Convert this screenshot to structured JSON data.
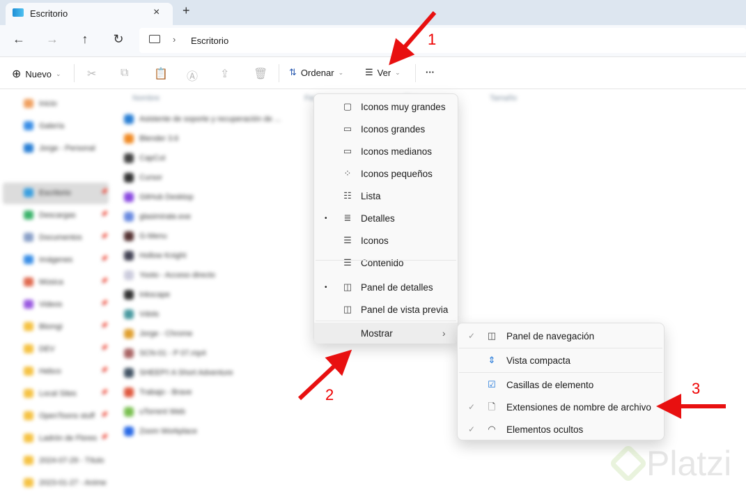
{
  "tab": {
    "title": "Escritorio",
    "new_tab": "+",
    "close": "×"
  },
  "nav": {
    "back": "←",
    "forward": "→",
    "up": "↑",
    "refresh": "↻",
    "breadcrumb": "Escritorio",
    "chevron": "›"
  },
  "toolbar": {
    "new_label": "Nuevo",
    "sort_label": "Ordenar",
    "view_label": "Ver",
    "more": "···"
  },
  "sidebar": {
    "items": [
      {
        "label": "Inicio",
        "color": "#f0a060"
      },
      {
        "label": "Galería",
        "color": "#3a8ee6"
      },
      {
        "label": "Jorge - Personal",
        "color": "#2a7fd4"
      },
      {
        "label": "Escritorio",
        "color": "#3aa0e0"
      },
      {
        "label": "Descargas",
        "color": "#3bb36b"
      },
      {
        "label": "Documentos",
        "color": "#8aa0c8"
      },
      {
        "label": "Imágenes",
        "color": "#3a8ee6"
      },
      {
        "label": "Música",
        "color": "#e06a50"
      },
      {
        "label": "Videos",
        "color": "#9a5ae0"
      },
      {
        "label": "Blomgi",
        "color": "#f5c243"
      },
      {
        "label": "DEV",
        "color": "#f5c243"
      },
      {
        "label": "Hebco",
        "color": "#f5c243"
      },
      {
        "label": "Local Sites",
        "color": "#f5c243"
      },
      {
        "label": "OpenToons stuff",
        "color": "#f5c243"
      },
      {
        "label": "Ladrón de Flores",
        "color": "#f5c243"
      },
      {
        "label": "2024-07-29 - Título",
        "color": "#f5c243"
      },
      {
        "label": "2023-01-27 - Anime",
        "color": "#f5c243"
      }
    ]
  },
  "list": {
    "headers": [
      "Nombre",
      "Fecha",
      "Tipo",
      "Tamaño"
    ],
    "files": [
      {
        "name": "Asistente de soporte y recuperación de ...",
        "color": "#2a7fd4"
      },
      {
        "name": "Blender 3.6",
        "color": "#f08a24"
      },
      {
        "name": "CapCut",
        "color": "#444"
      },
      {
        "name": "Cursor",
        "color": "#333"
      },
      {
        "name": "GitHub Desktop",
        "color": "#8a4ae0"
      },
      {
        "name": "glasimirate.exe",
        "color": "#6a8ae0"
      },
      {
        "name": "G-Menu",
        "color": "#533"
      },
      {
        "name": "Hollow Knight",
        "color": "#445"
      },
      {
        "name": "Yooto - Acceso directo",
        "color": "#ccd"
      },
      {
        "name": "Inkscape",
        "color": "#333"
      },
      {
        "name": "Vdots",
        "color": "#4a9aa0"
      },
      {
        "name": "Jorge - Chrome",
        "color": "#e0a030"
      },
      {
        "name": "SCN-01 - P 07.mp4",
        "color": "#a66"
      },
      {
        "name": "SHEEP!! A Short Adventure",
        "color": "#456"
      },
      {
        "name": "Trabajo - Brave",
        "color": "#e05a40"
      },
      {
        "name": "uTorrent Web",
        "color": "#7ac050"
      },
      {
        "name": "Zoom Workplace",
        "color": "#2a6ae6"
      }
    ]
  },
  "view_menu": {
    "items": [
      {
        "label": "Iconos muy grandes",
        "icon": "▢"
      },
      {
        "label": "Iconos grandes",
        "icon": "▭"
      },
      {
        "label": "Iconos medianos",
        "icon": "▭"
      },
      {
        "label": "Iconos pequeños",
        "icon": "⁘"
      },
      {
        "label": "Lista",
        "icon": "☷"
      },
      {
        "label": "Detalles",
        "icon": "≣",
        "bullet": "•"
      },
      {
        "label": "Iconos",
        "icon": "☰"
      },
      {
        "label": "Contenido",
        "icon": "☰"
      },
      {
        "label": "Panel de detalles",
        "icon": "◫",
        "bullet": "•"
      },
      {
        "label": "Panel de vista previa",
        "icon": "◫"
      }
    ],
    "show_label": "Mostrar",
    "show_chevron": "›"
  },
  "show_menu": {
    "items": [
      {
        "label": "Panel de navegación",
        "icon": "◫",
        "check": "✓"
      },
      {
        "label": "Vista compacta",
        "icon": "⇕"
      },
      {
        "label": "Casillas de elemento",
        "icon": "☑"
      },
      {
        "label": "Extensiones de nombre de archivo",
        "icon": "🗋",
        "check": "✓"
      },
      {
        "label": "Elementos ocultos",
        "icon": "◠",
        "check": "✓"
      }
    ]
  },
  "annotations": [
    "1",
    "2",
    "3"
  ],
  "watermark": "Platzi",
  "colors": {
    "arrow": "#e81010",
    "accent": "#1a73d8"
  }
}
